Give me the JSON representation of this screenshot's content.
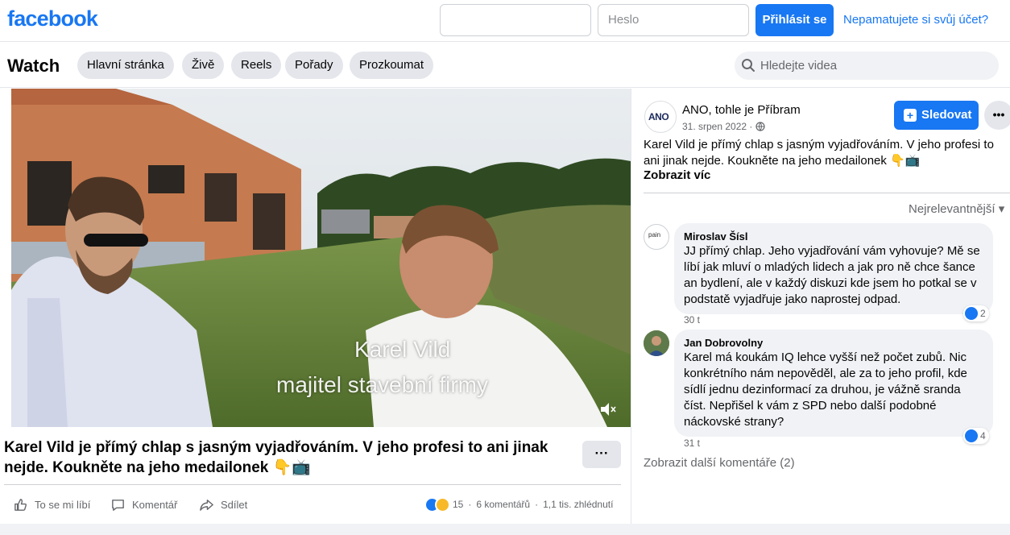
{
  "header": {
    "logo": "facebook",
    "email_placeholder": "",
    "password_placeholder": "Heslo",
    "login_label": "Přihlásit se",
    "forgot_label": "Nepamatujete si svůj účet?"
  },
  "watch": {
    "title": "Watch",
    "tabs": [
      "Hlavní stránka",
      "Živě",
      "Reels",
      "Pořady",
      "Prozkoumat"
    ],
    "search_placeholder": "Hledejte videa"
  },
  "video": {
    "overlay_name": "Karel Vild",
    "overlay_role": "majitel stavební firmy",
    "post_title": "Karel Vild je přímý chlap s jasným vyjadřováním. V jeho profesi to ani jinak nejde. Koukněte na jeho medailonek 👇📺",
    "more_label": "···",
    "actions": {
      "like": "To se mi líbí",
      "comment": "Komentář",
      "share": "Sdílet"
    },
    "stats": {
      "reactions": "15",
      "comments": "6 komentářů",
      "views": "1,1 tis. zhlédnutí",
      "separator": "·"
    }
  },
  "post": {
    "page_avatar_text": "ANO",
    "page_name": "ANO, tohle je Příbram",
    "date": "31. srpen 2022 ·",
    "follow_label": "Sledovat",
    "follow_plus": "+",
    "dots_label": "•••",
    "text": "Karel Vild je přímý chlap s jasným vyjadřováním. V jeho profesi to ani jinak nejde. Koukněte na jeho medailonek 👇📺",
    "see_more": "Zobrazit víc",
    "sort_label": "Nejrelevantnější ▾"
  },
  "comments": [
    {
      "name": "Miroslav Šísl",
      "text": "JJ přímý chlap. Jeho vyjadřování vám vyhovuje? Mě se líbí jak mluví o mladých lidech a jak pro ně chce šance an bydlení, ale v každý diskuzi kde jsem ho potkal se v podstatě vyjadřuje jako naprostej odpad.",
      "time": "30 t",
      "reactions": "2",
      "avatar_text": "pain"
    },
    {
      "name": "Jan Dobrovolny",
      "text": "Karel má koukám IQ lehce vyšší než počet zubů. Nic konkrétního nám nepověděl, ale za to jeho profil, kde sídlí jednu dezinformací za druhou, je vážně sranda číst. Nepřišel k vám z SPD nebo další podobné náckovské strany?",
      "time": "31 t",
      "reactions": "4"
    }
  ],
  "more_comments": "Zobrazit další komentáře (2)",
  "colors": {
    "brand": "#1877f2",
    "secondary_text": "#65676b",
    "chip_bg": "#e4e6eb",
    "bubble_bg": "#f0f2f5"
  }
}
